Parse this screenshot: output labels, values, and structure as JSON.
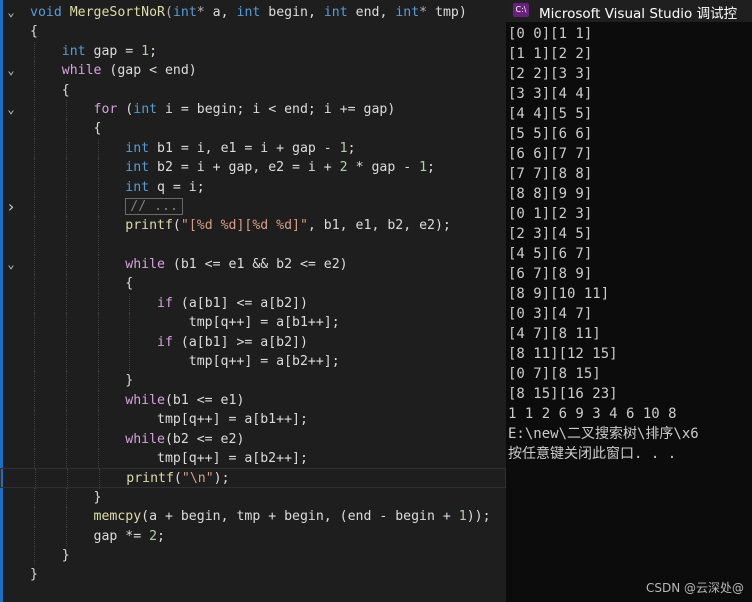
{
  "editor": {
    "lines": [
      {
        "fold": "down",
        "guides": [],
        "tokens": [
          [
            "kw",
            "void"
          ],
          [
            "var",
            " "
          ],
          [
            "fn",
            "MergeSortNoR"
          ],
          [
            "op",
            "("
          ],
          [
            "kw",
            "int"
          ],
          [
            "op",
            "* "
          ],
          [
            "var",
            "a, "
          ],
          [
            "kw",
            "int"
          ],
          [
            "var",
            " begin, "
          ],
          [
            "kw",
            "int"
          ],
          [
            "var",
            " end, "
          ],
          [
            "kw",
            "int"
          ],
          [
            "op",
            "* "
          ],
          [
            "var",
            "tmp)"
          ]
        ]
      },
      {
        "fold": "",
        "guides": [],
        "tokens": [
          [
            "var",
            "{"
          ]
        ]
      },
      {
        "fold": "",
        "guides": [
          1
        ],
        "tokens": [
          [
            "var",
            "    "
          ],
          [
            "kw",
            "int"
          ],
          [
            "var",
            " gap = "
          ],
          [
            "num",
            "1"
          ],
          [
            "var",
            ";"
          ]
        ]
      },
      {
        "fold": "down",
        "guides": [
          1
        ],
        "tokens": [
          [
            "var",
            "    "
          ],
          [
            "ctl",
            "while"
          ],
          [
            "var",
            " (gap < end)"
          ]
        ]
      },
      {
        "fold": "",
        "guides": [
          1
        ],
        "tokens": [
          [
            "var",
            "    {"
          ]
        ]
      },
      {
        "fold": "down",
        "guides": [
          1,
          2
        ],
        "tokens": [
          [
            "var",
            "        "
          ],
          [
            "ctl",
            "for"
          ],
          [
            "var",
            " ("
          ],
          [
            "kw",
            "int"
          ],
          [
            "var",
            " i = begin; i < end; i += gap)"
          ]
        ]
      },
      {
        "fold": "",
        "guides": [
          1,
          2
        ],
        "tokens": [
          [
            "var",
            "        {"
          ]
        ]
      },
      {
        "fold": "",
        "guides": [
          1,
          2,
          3
        ],
        "tokens": [
          [
            "var",
            "            "
          ],
          [
            "kw",
            "int"
          ],
          [
            "var",
            " b1 = i, e1 = i + gap - "
          ],
          [
            "num",
            "1"
          ],
          [
            "var",
            ";"
          ]
        ]
      },
      {
        "fold": "",
        "guides": [
          1,
          2,
          3
        ],
        "tokens": [
          [
            "var",
            "            "
          ],
          [
            "kw",
            "int"
          ],
          [
            "var",
            " b2 = i + gap, e2 = i + "
          ],
          [
            "num",
            "2"
          ],
          [
            "var",
            " * gap - "
          ],
          [
            "num",
            "1"
          ],
          [
            "var",
            ";"
          ]
        ]
      },
      {
        "fold": "",
        "guides": [
          1,
          2,
          3
        ],
        "tokens": [
          [
            "var",
            "            "
          ],
          [
            "kw",
            "int"
          ],
          [
            "var",
            " q = i;"
          ]
        ]
      },
      {
        "fold": "right",
        "guides": [
          1,
          2,
          3
        ],
        "collapsed": "// ...",
        "tokens": [
          [
            "var",
            "            "
          ]
        ]
      },
      {
        "fold": "",
        "guides": [
          1,
          2,
          3
        ],
        "tokens": [
          [
            "var",
            "            "
          ],
          [
            "fn",
            "printf"
          ],
          [
            "var",
            "("
          ],
          [
            "str",
            "\"[%d %d][%d %d]\""
          ],
          [
            "var",
            ", b1, e1, b2, e2);"
          ]
        ]
      },
      {
        "fold": "",
        "guides": [
          1,
          2,
          3
        ],
        "tokens": [
          [
            "var",
            ""
          ]
        ]
      },
      {
        "fold": "down",
        "guides": [
          1,
          2,
          3
        ],
        "tokens": [
          [
            "var",
            "            "
          ],
          [
            "ctl",
            "while"
          ],
          [
            "var",
            " (b1 <= e1 && b2 <= e2)"
          ]
        ]
      },
      {
        "fold": "",
        "guides": [
          1,
          2,
          3
        ],
        "tokens": [
          [
            "var",
            "            {"
          ]
        ]
      },
      {
        "fold": "",
        "guides": [
          1,
          2,
          3,
          4
        ],
        "tokens": [
          [
            "var",
            "                "
          ],
          [
            "ctl",
            "if"
          ],
          [
            "var",
            " (a[b1] <= a[b2])"
          ]
        ]
      },
      {
        "fold": "",
        "guides": [
          1,
          2,
          3,
          4
        ],
        "tokens": [
          [
            "var",
            "                    tmp[q++] = a[b1++];"
          ]
        ]
      },
      {
        "fold": "",
        "guides": [
          1,
          2,
          3,
          4
        ],
        "tokens": [
          [
            "var",
            "                "
          ],
          [
            "ctl",
            "if"
          ],
          [
            "var",
            " (a[b1] >= a[b2])"
          ]
        ]
      },
      {
        "fold": "",
        "guides": [
          1,
          2,
          3,
          4
        ],
        "tokens": [
          [
            "var",
            "                    tmp[q++] = a[b2++];"
          ]
        ]
      },
      {
        "fold": "",
        "guides": [
          1,
          2,
          3
        ],
        "tokens": [
          [
            "var",
            "            }"
          ]
        ]
      },
      {
        "fold": "",
        "guides": [
          1,
          2,
          3
        ],
        "tokens": [
          [
            "var",
            "            "
          ],
          [
            "ctl",
            "while"
          ],
          [
            "var",
            "(b1 <= e1)"
          ]
        ]
      },
      {
        "fold": "",
        "guides": [
          1,
          2,
          3
        ],
        "tokens": [
          [
            "var",
            "                tmp[q++] = a[b1++];"
          ]
        ]
      },
      {
        "fold": "",
        "guides": [
          1,
          2,
          3
        ],
        "tokens": [
          [
            "var",
            "            "
          ],
          [
            "ctl",
            "while"
          ],
          [
            "var",
            "(b2 <= e2)"
          ]
        ]
      },
      {
        "fold": "",
        "guides": [
          1,
          2,
          3
        ],
        "tokens": [
          [
            "var",
            "                tmp[q++] = a[b2++];"
          ]
        ]
      },
      {
        "fold": "",
        "guides": [
          1,
          2,
          3
        ],
        "highlight": true,
        "tokens": [
          [
            "var",
            "            "
          ],
          [
            "fn",
            "printf"
          ],
          [
            "var",
            "("
          ],
          [
            "str",
            "\"\\n\""
          ],
          [
            "var",
            ");"
          ]
        ]
      },
      {
        "fold": "",
        "guides": [
          1,
          2
        ],
        "tokens": [
          [
            "var",
            "        }"
          ]
        ]
      },
      {
        "fold": "",
        "guides": [
          1,
          2
        ],
        "tokens": [
          [
            "var",
            "        "
          ],
          [
            "fn",
            "memcpy"
          ],
          [
            "var",
            "(a + begin, tmp + begin, (end - begin + "
          ],
          [
            "num",
            "1"
          ],
          [
            "var",
            "));"
          ]
        ]
      },
      {
        "fold": "",
        "guides": [
          1,
          2
        ],
        "tokens": [
          [
            "var",
            "        gap *= "
          ],
          [
            "num",
            "2"
          ],
          [
            "var",
            ";"
          ]
        ]
      },
      {
        "fold": "",
        "guides": [
          1
        ],
        "tokens": [
          [
            "var",
            "    }"
          ]
        ]
      },
      {
        "fold": "",
        "guides": [],
        "tokens": [
          [
            "var",
            "}"
          ]
        ]
      }
    ]
  },
  "console": {
    "title": "Microsoft Visual Studio 调试控",
    "icon_label": "C:\\",
    "output_lines": [
      "[0 0][1 1]",
      "[1 1][2 2]",
      "[2 2][3 3]",
      "[3 3][4 4]",
      "[4 4][5 5]",
      "[5 5][6 6]",
      "[6 6][7 7]",
      "[7 7][8 8]",
      "[8 8][9 9]",
      "[0 1][2 3]",
      "[2 3][4 5]",
      "[4 5][6 7]",
      "[6 7][8 9]",
      "[8 9][10 11]",
      "[0 3][4 7]",
      "[4 7][8 11]",
      "[8 11][12 15]",
      "[0 7][8 15]",
      "[8 15][16 23]",
      "1 1 2 6 9 3 4 6 10 8",
      "E:\\new\\二叉搜索树\\排序\\x6",
      "按任意键关闭此窗口. . ."
    ],
    "watermark": "CSDN @云深处@"
  },
  "colors": {
    "keyword": "#569cd6",
    "control": "#d8a0df",
    "function": "#dcdcaa",
    "string": "#d69d85",
    "number": "#b5cea8",
    "text": "#dcdcdc",
    "editor_bg": "#1e1e1e",
    "console_bg": "#0c0c0c"
  }
}
